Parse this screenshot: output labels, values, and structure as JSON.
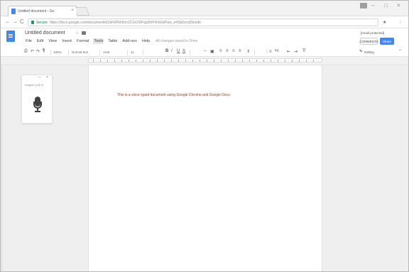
{
  "browser": {
    "tab_title": "Untitled document - Go",
    "tab_close": "×",
    "window_min": "–",
    "window_max": "□",
    "window_close": "×",
    "nav_back": "←",
    "nav_forward": "→",
    "nav_reload": "C",
    "secure_label": "Secure",
    "url": "https://docs.google.com/document/d/1bFbPbhDm1X1lcXDFqa5hFHhlXdxFwe_e4Sb5zcqDb/edit",
    "addr_star": "★",
    "addr_menu": "⋮"
  },
  "docs": {
    "title": "Untitled document",
    "star": "☆",
    "menu": [
      "File",
      "Edit",
      "View",
      "Insert",
      "Format",
      "Tools",
      "Table",
      "Add-ons",
      "Help"
    ],
    "save_status": "All changes saved in Drive",
    "user_email": "[email protected]",
    "comments_label": "COMMENTS",
    "share_label": "Share"
  },
  "toolbar": {
    "print": "⎙",
    "undo": "↶",
    "redo": "↷",
    "paint_format": "¶",
    "zoom": "100%",
    "style": "Normal text",
    "font": "Arial",
    "size": "11",
    "bold": "B",
    "italic": "I",
    "underline": "U",
    "text_color": "A",
    "link": "⇔",
    "comment": "▣",
    "align_left": "≡",
    "align_center": "≡",
    "align_right": "≡",
    "align_justify": "≡",
    "line_spacing": "⇕",
    "numbered_list": "⋮≡",
    "bulleted_list": "•≡",
    "indent_less": "⇤",
    "indent_more": "⇥",
    "clear_format": "T̸",
    "editing": "Editing",
    "pencil": "✎",
    "collapse": "⌃"
  },
  "voice": {
    "language": "English (US) ▾",
    "minimize": "—",
    "close": "×"
  },
  "document": {
    "body_text": "This is a voice typed document using Google Chrome and Google Docs."
  }
}
